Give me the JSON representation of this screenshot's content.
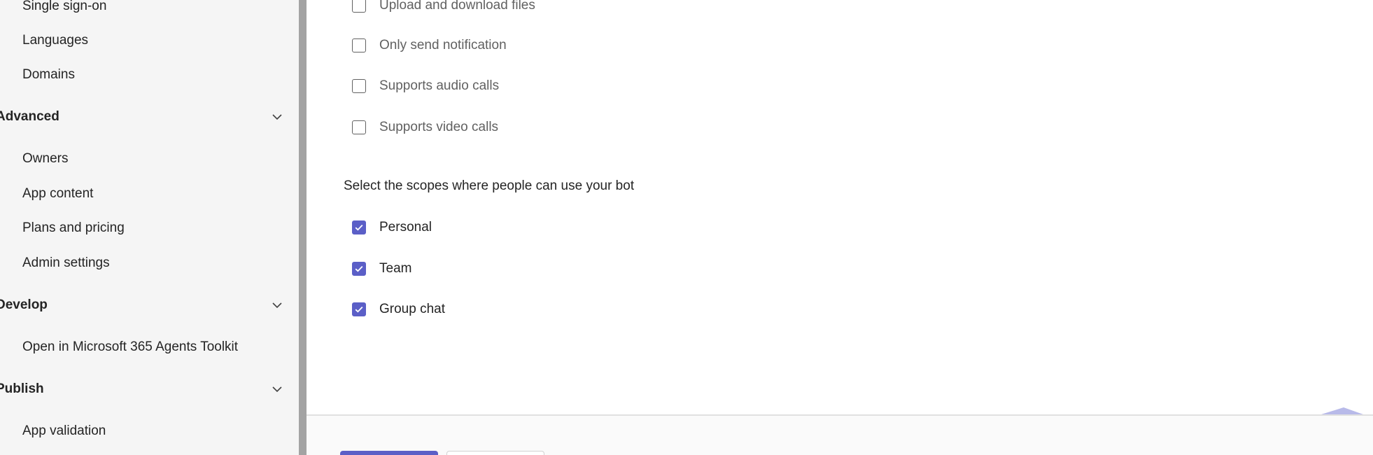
{
  "sidebar": {
    "items": [
      {
        "label": "Single sign-on"
      },
      {
        "label": "Languages"
      },
      {
        "label": "Domains"
      }
    ],
    "sections": [
      {
        "label": "Advanced",
        "items": [
          {
            "label": "Owners"
          },
          {
            "label": "App content"
          },
          {
            "label": "Plans and pricing"
          },
          {
            "label": "Admin settings"
          }
        ]
      },
      {
        "label": "Develop",
        "items": [
          {
            "label": "Open in Microsoft 365 Agents Toolkit"
          }
        ]
      },
      {
        "label": "Publish",
        "items": [
          {
            "label": "App validation"
          }
        ]
      }
    ]
  },
  "main": {
    "capabilities": [
      {
        "label": "Upload and download files",
        "checked": false
      },
      {
        "label": "Only send notification",
        "checked": false
      },
      {
        "label": "Supports audio calls",
        "checked": false
      },
      {
        "label": "Supports video calls",
        "checked": false
      }
    ],
    "scopes_heading": "Select the scopes where people can use your bot",
    "scopes": [
      {
        "label": "Personal",
        "checked": true
      },
      {
        "label": "Team",
        "checked": true
      },
      {
        "label": "Group chat",
        "checked": true
      }
    ]
  },
  "colors": {
    "accent": "#5b5fc7",
    "sidebar_bg": "#f5f5f5",
    "text_primary": "#242424",
    "text_muted": "#616161"
  },
  "icons": {
    "section_toggle": "chevron-down-icon",
    "checkmark": "checkmark-icon"
  }
}
